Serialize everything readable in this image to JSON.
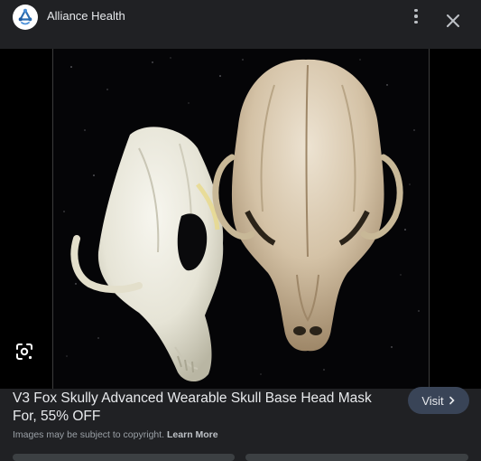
{
  "header": {
    "site_name": "Alliance Health",
    "logo_icon": "alliance-health-logo",
    "more_icon": "more-vert-icon",
    "close_icon": "close-icon"
  },
  "viewer": {
    "lens_icon": "google-lens-icon",
    "image_subject": "fox skull masks"
  },
  "result": {
    "title": "V3 Fox Skully Advanced Wearable Skull Base Head Mask For, 55% OFF",
    "visit_label": "Visit",
    "visit_icon": "chevron-right-icon",
    "copyright_text": "Images may be subject to copyright.",
    "learn_more": "Learn More"
  },
  "colors": {
    "background": "#202124",
    "visit_button": "#394457",
    "text": "#e8eaed",
    "muted": "#9aa0a6",
    "logo_accent": "#2b6cb0"
  }
}
